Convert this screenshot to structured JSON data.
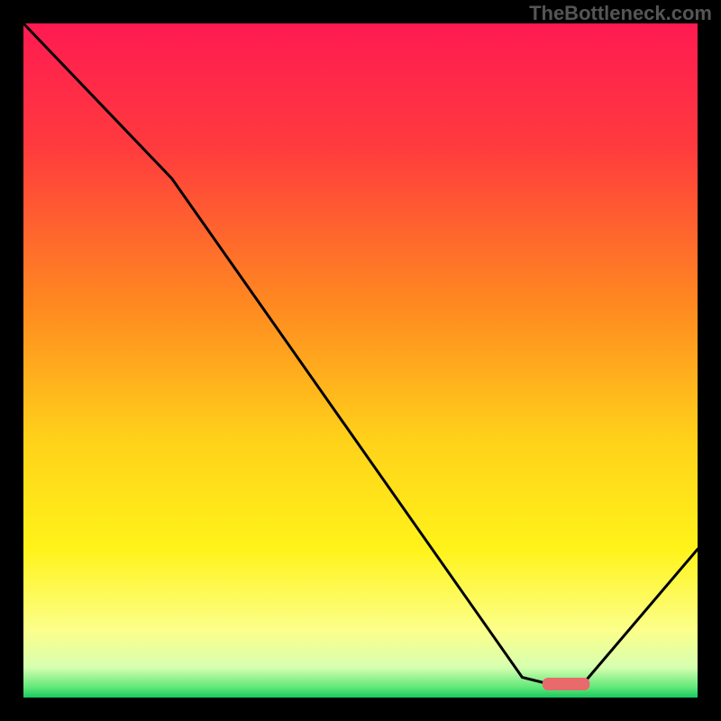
{
  "watermark": "TheBottleneck.com",
  "chart_data": {
    "type": "line",
    "title": "",
    "xlabel": "",
    "ylabel": "",
    "xlim": [
      0,
      100
    ],
    "ylim": [
      0,
      100
    ],
    "curve": [
      {
        "x": 0,
        "y": 100
      },
      {
        "x": 22,
        "y": 77
      },
      {
        "x": 74,
        "y": 3
      },
      {
        "x": 78,
        "y": 2
      },
      {
        "x": 83,
        "y": 2
      },
      {
        "x": 100,
        "y": 22
      }
    ],
    "marker": {
      "x0": 77,
      "x1": 84,
      "y": 2
    },
    "gradient_stops": [
      {
        "offset": 0.0,
        "color": "#ff1a52"
      },
      {
        "offset": 0.18,
        "color": "#ff3a3e"
      },
      {
        "offset": 0.42,
        "color": "#ff8a20"
      },
      {
        "offset": 0.62,
        "color": "#ffd21a"
      },
      {
        "offset": 0.78,
        "color": "#fff31a"
      },
      {
        "offset": 0.9,
        "color": "#fcff8a"
      },
      {
        "offset": 0.955,
        "color": "#d7ffb0"
      },
      {
        "offset": 0.985,
        "color": "#60e878"
      },
      {
        "offset": 1.0,
        "color": "#18c860"
      }
    ],
    "line_color": "#000000",
    "line_width": 3,
    "marker_color": "#e86a6a"
  }
}
